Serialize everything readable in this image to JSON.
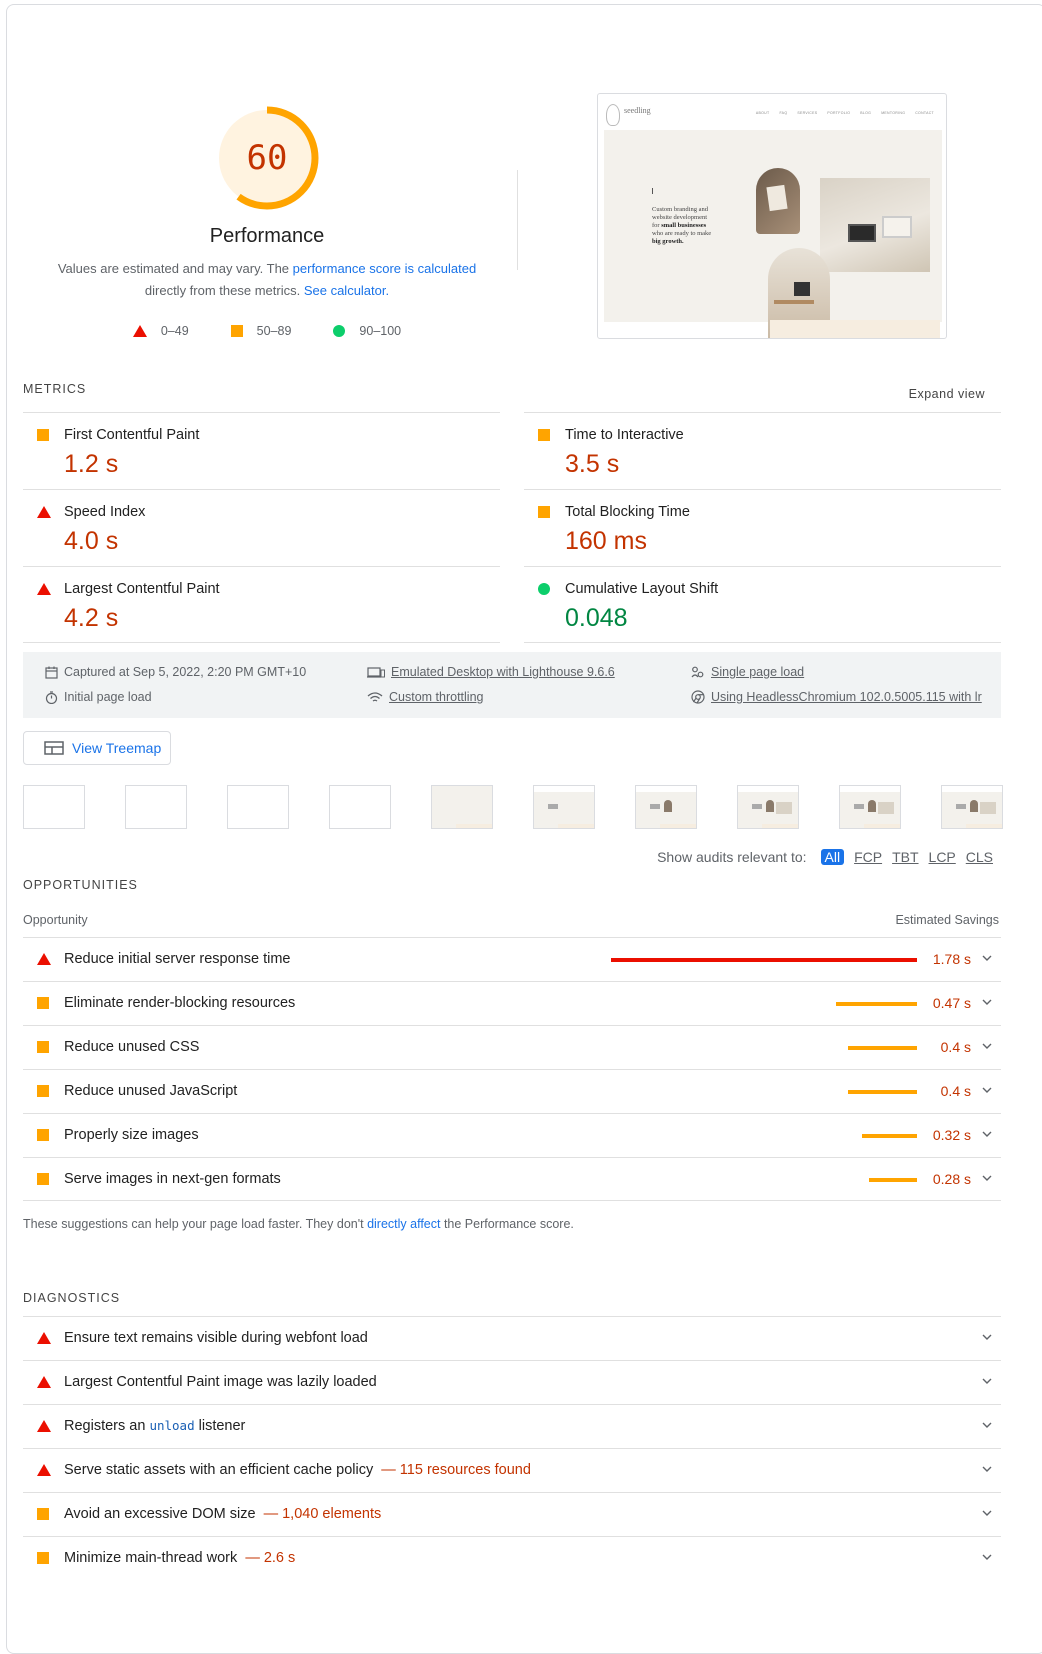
{
  "performance": {
    "score": "60",
    "score_fraction": 0.6,
    "title": "Performance",
    "desc_prefix": "Values are estimated and may vary. The ",
    "desc_link1": "performance score is calculated",
    "desc_mid": "directly from these metrics. ",
    "desc_link2": "See calculator.",
    "legend": [
      "0–49",
      "50–89",
      "90–100"
    ]
  },
  "screenshot": {
    "brand": "seedling",
    "nav": [
      "ABOUT",
      "FAQ",
      "SERVICES",
      "PORTFOLIO",
      "BLOG",
      "MENTORING",
      "CONTACT"
    ],
    "text_lines": [
      "Custom branding and",
      "website development",
      "for",
      "small businesses",
      "who are ready to make",
      "big growth."
    ]
  },
  "metrics": {
    "section_title": "METRICS",
    "expand_label": "Expand view",
    "items": [
      {
        "title": "First Contentful Paint",
        "value": "1.2 s",
        "rating": "average"
      },
      {
        "title": "Time to Interactive",
        "value": "3.5 s",
        "rating": "average"
      },
      {
        "title": "Speed Index",
        "value": "4.0 s",
        "rating": "fail"
      },
      {
        "title": "Total Blocking Time",
        "value": "160 ms",
        "rating": "average"
      },
      {
        "title": "Largest Contentful Paint",
        "value": "4.2 s",
        "rating": "fail"
      },
      {
        "title": "Cumulative Layout Shift",
        "value": "0.048",
        "rating": "pass"
      }
    ]
  },
  "info": {
    "captured": "Captured at Sep 5, 2022, 2:20 PM GMT+10",
    "initial": "Initial page load",
    "device": "Emulated Desktop with Lighthouse 9.6.6",
    "throttling": "Custom throttling",
    "single": "Single page load",
    "browser": "Using HeadlessChromium 102.0.5005.115 with lr"
  },
  "treemap_label": "View Treemap",
  "filters": {
    "label": "Show audits relevant to:",
    "chips": [
      "All",
      "FCP",
      "TBT",
      "LCP",
      "CLS"
    ]
  },
  "opportunities": {
    "section_title": "OPPORTUNITIES",
    "col_left": "Opportunity",
    "col_right": "Estimated Savings",
    "items": [
      {
        "title": "Reduce initial server response time",
        "savings": "1.78 s",
        "seconds": 1.78,
        "rating": "fail"
      },
      {
        "title": "Eliminate render-blocking resources",
        "savings": "0.47 s",
        "seconds": 0.47,
        "rating": "average"
      },
      {
        "title": "Reduce unused CSS",
        "savings": "0.4 s",
        "seconds": 0.4,
        "rating": "average"
      },
      {
        "title": "Reduce unused JavaScript",
        "savings": "0.4 s",
        "seconds": 0.4,
        "rating": "average"
      },
      {
        "title": "Properly size images",
        "savings": "0.32 s",
        "seconds": 0.32,
        "rating": "average"
      },
      {
        "title": "Serve images in next-gen formats",
        "savings": "0.28 s",
        "seconds": 0.28,
        "rating": "average"
      }
    ],
    "note_prefix": "These suggestions can help your page load faster. They don't ",
    "note_link": "directly affect",
    "note_suffix": " the Performance score."
  },
  "diagnostics": {
    "section_title": "DIAGNOSTICS",
    "items": [
      {
        "title": "Ensure text remains visible during webfont load",
        "rating": "fail"
      },
      {
        "title": "Largest Contentful Paint image was lazily loaded",
        "rating": "fail"
      },
      {
        "title_pre": "Registers an ",
        "code": "unload",
        "title_post": " listener",
        "rating": "fail"
      },
      {
        "title": "Serve static assets with an efficient cache policy",
        "extra": "— 115 resources found",
        "rating": "fail"
      },
      {
        "title": "Avoid an excessive DOM size",
        "extra": "— 1,040 elements",
        "rating": "average"
      },
      {
        "title": "Minimize main-thread work",
        "extra": "— 2.6 s",
        "rating": "average"
      }
    ]
  },
  "colors": {
    "fail": "#eb0f00",
    "average": "#ffa400",
    "pass": "#0cce6b",
    "link": "#1a73e8"
  }
}
